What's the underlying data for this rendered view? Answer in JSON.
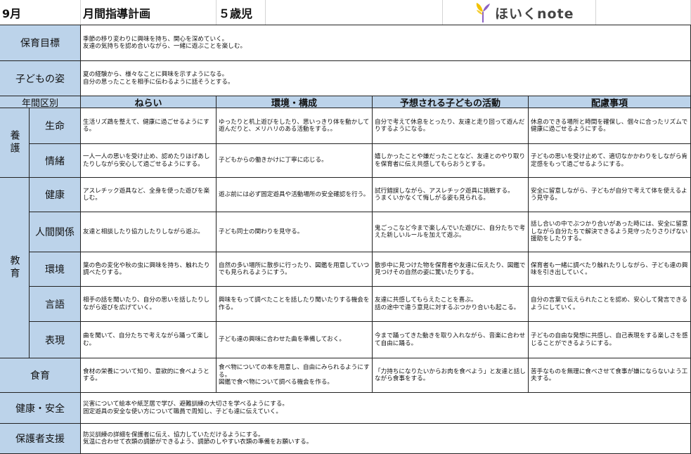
{
  "header": {
    "month": "9月",
    "doc_title": "月間指導計画",
    "age": "５歳児",
    "logo_text": "ほいくnote"
  },
  "goals": {
    "hoiku_label": "保育目標",
    "hoiku_text": "季節の移り変わりに興味を持ち、関心を深めていく。\n友達の気持ちを認め合いながら、一緒に遊ぶことを楽しむ。",
    "kodomo_label": "子どもの姿",
    "kodomo_text": "夏の経験から、様々なことに興味を示すようになる。\n自分の思ったことを相手に伝わるように話そうとする。"
  },
  "columns": {
    "nenkan": "年間区別",
    "nerai": "ねらい",
    "kankyo": "環境・構成",
    "yoso": "予想される子どもの活動",
    "hairyo": "配慮事項"
  },
  "groups": {
    "yogo": "養護",
    "kyoiku": "教育"
  },
  "rows": {
    "seimei": {
      "label": "生命",
      "nerai": "生活リズ鵡を整えて、健康に過ごせるようにする。",
      "kankyo": "ゆったりと机上遊びをしたり、思いっきり体を動かして遊んだりと、メリハリのある活動をする。。",
      "yoso": "自分で考えて休息をとったり、友達と走り回って遊んだりするようになる。",
      "hairyo": "休息のできる場所と時間を確保し、個々に合ったリズムで健康に過ごせるようにする。"
    },
    "jocho": {
      "label": "情緒",
      "nerai": "一人一人の思いを受け止め、認めたりほげあしたりしながら安心して過ごせるようにする。",
      "kankyo": "子どもからの働きかけに丁寧に応じる。",
      "yoso": "嬉しかったことや嫌だったことなど、友達とのやり取りを保育者に伝え共感してもらおうとする。",
      "hairyo": "子どもの思いを受け止めて、適切なかかわりをしながら肯定感をもって過ごせるようにする。"
    },
    "kenko": {
      "label": "健康",
      "nerai": "アスレチック遊具など、全身を使った遊びを楽しむ。",
      "kankyo": "遊ぶ前には必ず固定遊具や活動場所の安全確認を行う。",
      "yoso": "試行錯誤しながら、アスレチック遊具に挑戦する。\nうまくいかなくて悔しがる姿も見られる。",
      "hairyo": "安全に留意しながら、子どもが自分で考えて体を使えるよう見守る。"
    },
    "ningen": {
      "label": "人間関係",
      "nerai": "友達と相談したり協力したりしながら遊ぶ。",
      "kankyo": "子ども同士の関わりを見守る。",
      "yoso": "鬼ごっこなど今まで楽しんでいた遊びに、自分たちで考えた新しいルールを加えて遊ぶ。",
      "hairyo": "話し合いの中でぶつかり合いがあった時には、安全に留意しながら自分たちで解決できるよう見守ったりさりげない援助をしたりする。"
    },
    "kankyo": {
      "label": "環境",
      "nerai": "葉の色の変化や秋の虫に興味を持ち、触れたり調べたりする。",
      "kankyo": "自然の多い場所に散歩に行ったり、図鑑を用意していつでも見られるようにすう。",
      "yoso": "散歩中に見つけた物を保育者や友達に伝えたり、図鑑で見つけその自然の姿に驚いたりする。",
      "hairyo": "保育者も一緒に調べたり触れたりしながら、子ども達の興味を引き出していく。"
    },
    "gengo": {
      "label": "言語",
      "nerai": "相手の話を聞いたり、自分の思いを話したりしながら遊びを広げていく。",
      "kankyo": "興味をもって調べたことを話したり聞いたりする機会を作る。",
      "yoso": "友達に共感してもらえたことを喜ぶ。\n話の途中で違う意見に対するぶつかり合いも起こる。",
      "hairyo": "自分の言葉で伝えられたことを認め、安心して発言できるようにしていく。"
    },
    "hyogen": {
      "label": "表現",
      "nerai": "曲を聞いて、自分たちで考えながら踊って楽しむ。",
      "kankyo": "子ども達の興味に合わせた曲を準備しておく。",
      "yoso": "今まで踊ってきた動きを取り入れながら、音楽に合わせて自由に踊る。",
      "hairyo": "子どもの自由な発想に共感し、自己表現をする楽しさを感じることができるようにする。"
    },
    "shokuiku": {
      "label": "食育",
      "nerai": "食材の栄養について知り、意欲的に食べようとする。",
      "kankyo": "食べ物についての本を用意し、自由にみられるようにする。\n図鑑で食べ物について調べる機会を作る。",
      "yoso": "「力持ちになりたいからお肉を食べよう」と友達と話しながら食事をする。",
      "hairyo": "苦手なものを無理に食べさせて食事が嫌にならないよう工夫する。"
    }
  },
  "bottom": {
    "anzen_label": "健康・安全",
    "anzen_text": "災害について絵本や紙芝居で学び、避難訓練の大切さを学べるようにする。\n固定遊具の安全な使い方について職員で周知し、子ども達に伝えていく。",
    "hogosha_label": "保護者支援",
    "hogosha_text": "防災訓練の詳細を保護者に伝え、協力していただけるようにする。\n気温に合わせて衣類の調節ができるよう、調節のしやすい衣類の準備をお願いする。"
  },
  "colors": {
    "label_bg": "#bcd3ea",
    "border": "#222222",
    "logo_yellow": "#f2c200",
    "logo_purple": "#8c62c4"
  }
}
